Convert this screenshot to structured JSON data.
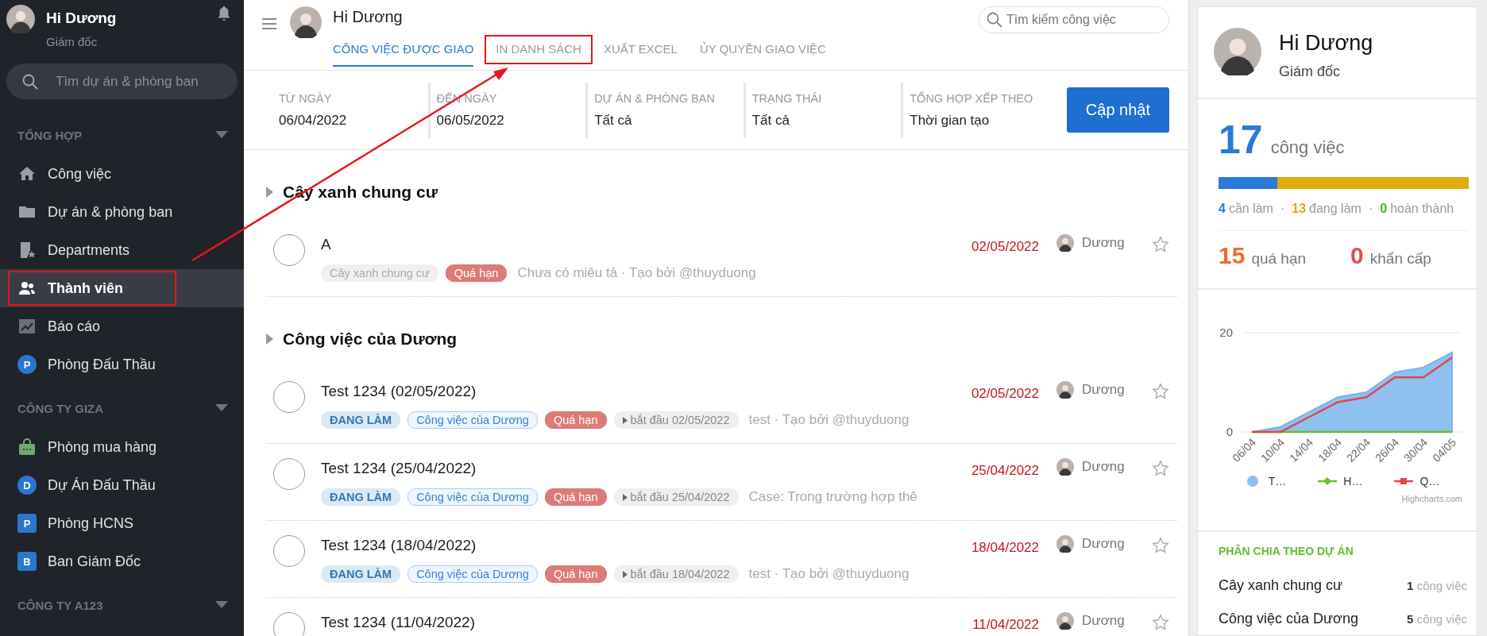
{
  "sidebar": {
    "user": {
      "name": "Hi Dương",
      "role": "Giám đốc"
    },
    "search": {
      "placeholder": "Tìm dự án & phòng ban"
    },
    "sections": [
      {
        "title": "TỔNG HỢP",
        "expanded": true,
        "items": [
          {
            "kind": "icon",
            "label": "Công việc",
            "selected": false,
            "highlighted": false
          },
          {
            "kind": "icon",
            "label": "Dự án & phòng ban",
            "selected": false,
            "highlighted": false
          },
          {
            "kind": "icon",
            "label": "Departments",
            "selected": false,
            "highlighted": false
          },
          {
            "kind": "icon",
            "label": "Thành viên",
            "selected": true,
            "highlighted": true
          },
          {
            "kind": "icon",
            "label": "Báo cáo",
            "selected": false,
            "highlighted": false
          },
          {
            "kind": "circle-letter",
            "badge": "P",
            "label": "Phòng Đấu Thầu",
            "selected": false,
            "highlighted": false
          }
        ]
      },
      {
        "title": "CÔNG TY GIZA",
        "expanded": true,
        "items": [
          {
            "kind": "icon",
            "label": "Phòng mua hàng",
            "selected": false,
            "highlighted": false
          },
          {
            "kind": "circle-letter",
            "badge": "D",
            "label": "Dự Án Đấu Thầu",
            "selected": false,
            "highlighted": false
          },
          {
            "kind": "square-letter",
            "badge": "P",
            "label": "Phòng HCNS",
            "selected": false,
            "highlighted": false
          },
          {
            "kind": "square-letter",
            "badge": "B",
            "label": "Ban Giám Đốc",
            "selected": false,
            "highlighted": false
          }
        ]
      },
      {
        "title": "CÔNG TY A123",
        "expanded": true
      }
    ]
  },
  "header": {
    "name": "Hi Dương",
    "search": {
      "placeholder": "Tìm kiếm công việc"
    },
    "tabs": [
      {
        "label": "CÔNG VIỆC ĐƯỢC GIAO",
        "selected": true,
        "highlighted": false
      },
      {
        "label": "IN DANH SÁCH",
        "selected": false,
        "highlighted": true
      },
      {
        "label": "XUẤT EXCEL",
        "selected": false,
        "highlighted": false
      },
      {
        "label": "ỦY QUYỀN GIAO VIỆC",
        "selected": false,
        "highlighted": false
      }
    ]
  },
  "filters": [
    {
      "label": "TỪ NGÀY",
      "value": "06/04/2022"
    },
    {
      "label": "ĐẾN NGÀY",
      "value": "06/05/2022"
    },
    {
      "label": "DỰ ÁN & PHÒNG BAN",
      "value": "Tất cả"
    },
    {
      "label": "TRẠNG THÁI",
      "value": "Tất cả"
    },
    {
      "label": "TỔNG HỢP XẾP THEO",
      "value": "Thời gian tạo"
    }
  ],
  "update_button": "Cập nhật",
  "groups": [
    {
      "title": "Cây xanh chung cư",
      "expanded": false,
      "tasks": [
        {
          "title": "A",
          "done": false,
          "tags": [
            {
              "kind": "project",
              "text": "Cây xanh chung cư"
            },
            {
              "kind": "overdue",
              "text": "Quá hạn"
            }
          ],
          "description": "Chưa có miêu tả · Tạo bởi @thuyduong",
          "date": "02/05/2022",
          "assignee": "Dương",
          "starred": false
        }
      ]
    },
    {
      "title": "Công việc của Dương",
      "expanded": false,
      "tasks": [
        {
          "title": "Test 1234 (02/05/2022)",
          "done": false,
          "tags": [
            {
              "kind": "status",
              "text": "ĐANG LÀM"
            },
            {
              "kind": "group",
              "text": "Công việc của Dương"
            },
            {
              "kind": "overdue",
              "text": "Quá hạn"
            },
            {
              "kind": "start",
              "text": "bắt đầu 02/05/2022"
            }
          ],
          "description": "test · Tạo bởi @thuyduong",
          "date": "02/05/2022",
          "assignee": "Dương",
          "starred": false
        },
        {
          "title": "Test 1234 (25/04/2022)",
          "done": false,
          "tags": [
            {
              "kind": "status",
              "text": "ĐANG LÀM"
            },
            {
              "kind": "group",
              "text": "Công việc của Dương"
            },
            {
              "kind": "overdue",
              "text": "Quá hạn"
            },
            {
              "kind": "start",
              "text": "bắt đầu 25/04/2022"
            }
          ],
          "description": "Case:  Trong trường hợp thê",
          "date": "25/04/2022",
          "assignee": "Dương",
          "starred": false
        },
        {
          "title": "Test 1234 (18/04/2022)",
          "done": false,
          "tags": [
            {
              "kind": "status",
              "text": "ĐANG LÀM"
            },
            {
              "kind": "group",
              "text": "Công việc của Dương"
            },
            {
              "kind": "overdue",
              "text": "Quá hạn"
            },
            {
              "kind": "start",
              "text": "bắt đầu 18/04/2022"
            }
          ],
          "description": "test · Tạo bởi @thuyduong",
          "date": "18/04/2022",
          "assignee": "Dương",
          "starred": false
        },
        {
          "title": "Test 1234 (11/04/2022)",
          "done": false,
          "date": "11/04/2022",
          "assignee": "Dương",
          "starred": false
        }
      ]
    }
  ],
  "profile": {
    "name": "Hi Dương",
    "role": "Giám đốc"
  },
  "summary": {
    "total": "17",
    "total_label": "công việc",
    "separator": "·",
    "segments": [
      {
        "level": 0.235,
        "color": "#2a7ad9"
      },
      {
        "level": 0.765,
        "color": "#dcab0c"
      }
    ],
    "counts": [
      {
        "count": "4",
        "caption": "cần làm",
        "color": "#2a7ad9"
      },
      {
        "count": "13",
        "caption": "đang làm",
        "color": "#dcab0c"
      },
      {
        "count": "0",
        "caption": "hoàn thành",
        "color": "#4caf20"
      }
    ],
    "alerts": [
      {
        "value": "15",
        "label": "quá hạn",
        "color": "#f26b2f"
      },
      {
        "value": "0",
        "label": "khẩn cấp",
        "color": "#d9534f"
      }
    ]
  },
  "chart": {
    "chart_data": {
      "type": "area",
      "categories": [
        "06/04",
        "10/04",
        "14/04",
        "18/04",
        "22/04",
        "26/04",
        "30/04",
        "04/05"
      ],
      "yticks": [
        0,
        20
      ],
      "ylim": [
        0,
        20
      ],
      "series": [
        {
          "name": "T…",
          "color": "#90c0ef",
          "values": [
            0,
            1,
            4,
            7,
            8,
            12,
            13,
            16
          ]
        },
        {
          "name": "H…",
          "type": "line",
          "color": "#6cbf2a",
          "values": [
            0,
            0,
            0,
            0,
            0,
            0,
            0,
            0
          ]
        },
        {
          "name": "Q…",
          "type": "line",
          "color": "#e0484c",
          "values": [
            0,
            0,
            3,
            6,
            7,
            11,
            11,
            15
          ]
        }
      ]
    },
    "credit": "Highcharts.com"
  },
  "projects": {
    "title": "PHÂN CHIA THEO DỰ ÁN",
    "rows": [
      {
        "name": "Cây xanh chung cư",
        "count": "1",
        "unit": "công việc"
      },
      {
        "name": "Công việc của Dương",
        "count": "5",
        "unit": "công việc"
      }
    ]
  }
}
